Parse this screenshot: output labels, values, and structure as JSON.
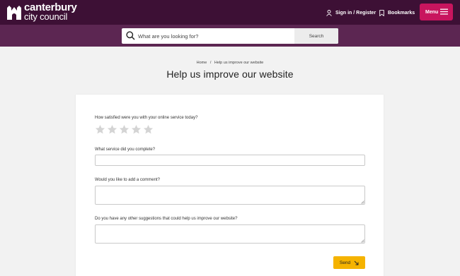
{
  "header": {
    "logo_line1": "canterbury",
    "logo_line2": "city council",
    "signin_label": "Sign in / Register",
    "bookmarks_label": "Bookmarks",
    "menu_label": "Menu",
    "colors": {
      "topbar": "#3d1035",
      "searchbar": "#5c2652",
      "menu": "#c8155e"
    }
  },
  "search": {
    "placeholder": "What are you looking for?",
    "button_label": "Search"
  },
  "breadcrumb": {
    "home": "Home",
    "separator": "/",
    "current": "Help us improve our website"
  },
  "page": {
    "title": "Help us improve our website"
  },
  "form": {
    "rating_question": "How satisfied were you with your online service today?",
    "rating_max": 5,
    "rating_value": 0,
    "service_question": "What service did you complete?",
    "service_value": "",
    "comment_question": "Would you like to add a comment?",
    "comment_value": "",
    "suggestions_question": "Do you have any other suggestions that could help us improve our website?",
    "suggestions_value": "",
    "send_label": "Send",
    "send_color": "#f5b300"
  }
}
